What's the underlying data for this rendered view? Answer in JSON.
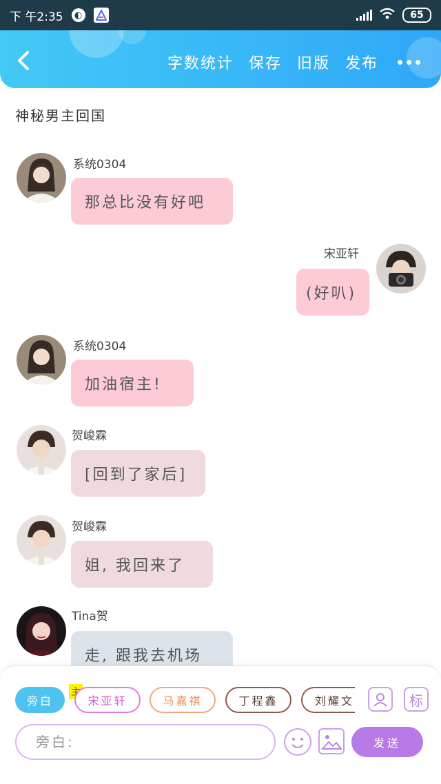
{
  "status_bar": {
    "time": "下 午2:35",
    "battery": "65"
  },
  "header": {
    "actions": [
      "字数统计",
      "保存",
      "旧版",
      "发布"
    ]
  },
  "story": {
    "title": "神秘男主回国"
  },
  "messages": [
    {
      "sender": "系统0304",
      "text": "那总比没有好吧",
      "side": "left",
      "bubble_color": "#fccbd6",
      "avatar": "girl-white-sweater"
    },
    {
      "sender": "宋亚轩",
      "text": "(好叭)",
      "side": "right",
      "bubble_color": "#fccbd6",
      "avatar": "boy-camera"
    },
    {
      "sender": "系统0304",
      "text": "加油宿主!",
      "side": "left",
      "bubble_color": "#fccbd6",
      "avatar": "girl-white-sweater"
    },
    {
      "sender": "贺峻霖",
      "text": "[回到了家后]",
      "side": "left",
      "bubble_color": "#f0dade",
      "avatar": "boy-white-shirt"
    },
    {
      "sender": "贺峻霖",
      "text": "姐, 我回来了",
      "side": "left",
      "bubble_color": "#f0dade",
      "avatar": "boy-white-shirt"
    },
    {
      "sender": "Tina贺",
      "text": "走, 跟我去机场",
      "side": "left",
      "bubble_color": "#dde3ea",
      "avatar": "girl-red-hair"
    }
  ],
  "composer": {
    "narration_chip": "旁白",
    "main_tag": "主",
    "roles": [
      "宋亚轩",
      "马嘉祺",
      "丁程鑫",
      "刘耀文"
    ],
    "tag_button": "标",
    "input_placeholder": "旁白:",
    "send_label": "发送"
  },
  "colors": {
    "header_start": "#43c9f5",
    "header_end": "#2fa8f8",
    "send_button": "#b77ae6",
    "narration_chip": "#4fc3f0"
  }
}
